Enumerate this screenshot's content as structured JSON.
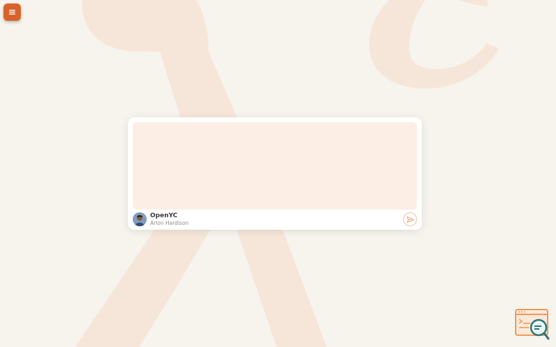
{
  "app": {
    "name": "OpenYC",
    "user_name": "Arlon Hardison"
  },
  "composer": {
    "value": "",
    "placeholder": ""
  },
  "icons": {
    "menu": "hamburger-menu-icon",
    "send": "send-icon",
    "help": "terminal-search-icon",
    "avatar": "user-avatar"
  },
  "colors": {
    "background": "#f6f4ec",
    "background_logo": "#f6e6da",
    "accent": "#d9622b",
    "prompt_fill": "#fdeee5",
    "send_accent": "#f0a37c",
    "help_orange": "#eb9a5c",
    "help_teal": "#2c7379"
  }
}
